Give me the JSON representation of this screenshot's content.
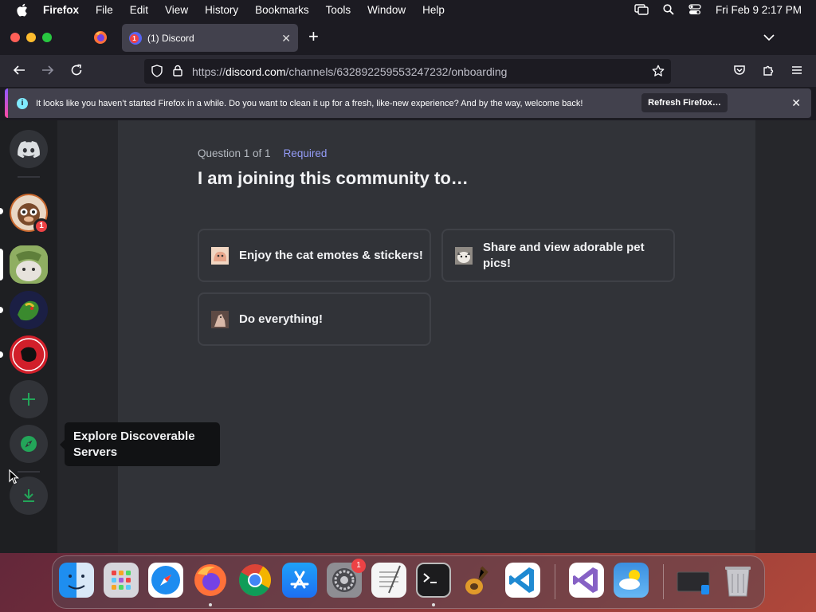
{
  "menubar": {
    "app_name": "Firefox",
    "items": [
      "File",
      "Edit",
      "View",
      "History",
      "Bookmarks",
      "Tools",
      "Window",
      "Help"
    ],
    "clock": "Fri Feb 9  2:17 PM"
  },
  "browser": {
    "tab_title": "(1) Discord",
    "tab_badge": "1",
    "url_prefix": "https://",
    "url_host": "discord.com",
    "url_path": "/channels/632892259553247232/onboarding",
    "infobar_message": "It looks like you haven’t started Firefox in a while. Do you want to clean it up for a fresh, like-new experience? And by the way, welcome back!",
    "infobar_button": "Refresh Firefox…"
  },
  "discord": {
    "guild_badge": "1",
    "question_counter": "Question 1 of 1",
    "required_label": "Required",
    "question_title": "I am joining this community to…",
    "options": [
      {
        "label": "Enjoy the cat emotes & stickers!"
      },
      {
        "label": "Share and view adorable pet pics!"
      },
      {
        "label": "Do everything!"
      }
    ],
    "tooltip": "Explore Discoverable Servers"
  },
  "dock": {
    "apps": [
      "finder-icon",
      "launchpad-icon",
      "safari-icon",
      "firefox-icon",
      "chrome-icon",
      "app-store-icon",
      "system-settings-icon",
      "textedit-icon",
      "terminal-icon",
      "garageband-icon",
      "vscode-icon",
      "visual-studio-icon",
      "weather-icon",
      "screen-icon",
      "trash-icon"
    ],
    "settings_badge": "1"
  },
  "colors": {
    "discord_blurple": "#5865f2",
    "required_purple": "#949cf7",
    "discord_green": "#23a559",
    "mention_red": "#ed4245"
  }
}
